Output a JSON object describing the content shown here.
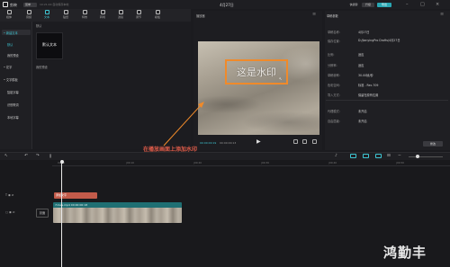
{
  "titlebar": {
    "app_name": "剪映",
    "menu_label": "菜单",
    "autosave": "10:21:44 自动保存本地",
    "doc_title": "4月27日",
    "btn_shortcut": "快捷键",
    "btn_upgrade": "升级",
    "btn_export": "导出",
    "accent": "#3ec7d4",
    "export_color": "#2aa7b3"
  },
  "toolbar": {
    "items": [
      {
        "label": "媒体",
        "icon": "media-icon"
      },
      {
        "label": "音频",
        "icon": "audio-icon"
      },
      {
        "label": "文本",
        "icon": "text-icon",
        "active": true
      },
      {
        "label": "贴纸",
        "icon": "sticker-icon"
      },
      {
        "label": "特效",
        "icon": "effects-icon"
      },
      {
        "label": "转场",
        "icon": "transition-icon"
      },
      {
        "label": "滤镜",
        "icon": "filter-icon"
      },
      {
        "label": "调节",
        "icon": "adjust-icon"
      },
      {
        "label": "模板",
        "icon": "template-icon"
      }
    ]
  },
  "leftnav": {
    "items": [
      {
        "label": "• 新建文本",
        "active": true
      },
      {
        "label": "默认",
        "active": true
      },
      {
        "label": "我的预设"
      },
      {
        "label": "• 花字"
      },
      {
        "label": "• 文字模板"
      },
      {
        "label": "智能字幕"
      },
      {
        "label": "识别歌词"
      },
      {
        "label": "本地字幕"
      }
    ]
  },
  "assets": {
    "header": "默认",
    "tile_label": "默认文本",
    "sub_header": "我的预设"
  },
  "player": {
    "title": "播放器",
    "watermark_text": "这是水印",
    "time_current": "00:00:00:19",
    "time_total": "00:00:00:13",
    "ratio_label": "比例"
  },
  "props": {
    "title": "草稿参数",
    "rows": [
      {
        "label": "草稿名称:",
        "value": "4月27日"
      },
      {
        "label": "保存位置:",
        "value": "D:/JianyingPro Drafts/4月27日"
      },
      {
        "label": "比例:",
        "value": "适应"
      },
      {
        "label": "分辨率:",
        "value": "适应"
      },
      {
        "label": "草稿帧率:",
        "value": "30.00帧/秒"
      },
      {
        "label": "色彩空间:",
        "value": "标准 - Rec.709"
      },
      {
        "label": "导入方式:",
        "value": "保留在原有位置"
      },
      {
        "label": "代理模式:",
        "value": "未开启"
      },
      {
        "label": "自由层级:",
        "value": "未开启"
      }
    ],
    "edit_button": "修改"
  },
  "timeline": {
    "ticks": [
      "00:00",
      "|00:10",
      "|00:20",
      "|00:30",
      "|00:40",
      "|00:50"
    ],
    "text_clip": "添加文字",
    "video_clip": "7c1ee.mp4 00:00:00:18",
    "cover_label": "封面"
  },
  "annotation": {
    "text": "在播放画面上添加水印",
    "color": "#e25d4a"
  },
  "brand_mark": "鸿勤丰"
}
